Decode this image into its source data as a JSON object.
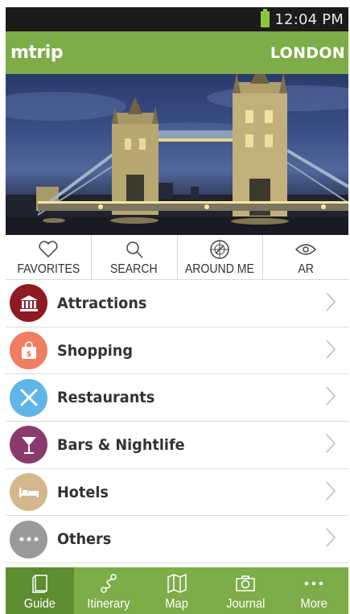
{
  "status_bar": {
    "time": "12:04 PM",
    "battery_color": "#8cc63f"
  },
  "app_bar": {
    "logo": "mtrip",
    "city": "LONDON",
    "color": "#7dac48"
  },
  "quick_actions": [
    {
      "label": "FAVORITES",
      "icon": "heart-icon"
    },
    {
      "label": "SEARCH",
      "icon": "search-icon"
    },
    {
      "label": "AROUND ME",
      "icon": "compass-icon"
    },
    {
      "label": "AR",
      "icon": "eye-icon"
    }
  ],
  "categories": [
    {
      "label": "Attractions",
      "icon": "museum-icon",
      "color": "#8e1b22"
    },
    {
      "label": "Shopping",
      "icon": "shopping-bag-icon",
      "color": "#ef7e63"
    },
    {
      "label": "Restaurants",
      "icon": "cutlery-icon",
      "color": "#5fb6e6"
    },
    {
      "label": "Bars & Nightlife",
      "icon": "cocktail-icon",
      "color": "#8a3b6b"
    },
    {
      "label": "Hotels",
      "icon": "bed-icon",
      "color": "#d5b78d"
    },
    {
      "label": "Others",
      "icon": "more-dots-icon",
      "color": "#9a9a9a"
    }
  ],
  "tabs": [
    {
      "label": "Guide",
      "icon": "guide-book-icon",
      "active": true
    },
    {
      "label": "Itinerary",
      "icon": "route-icon",
      "active": false
    },
    {
      "label": "Map",
      "icon": "map-icon",
      "active": false
    },
    {
      "label": "Journal",
      "icon": "camera-icon",
      "active": false
    },
    {
      "label": "More",
      "icon": "more-dots-icon",
      "active": false
    }
  ]
}
